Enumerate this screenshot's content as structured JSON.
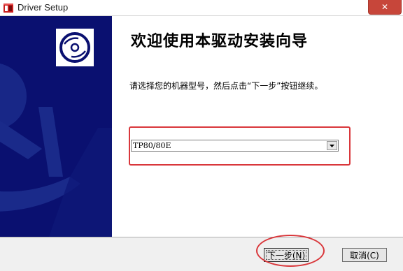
{
  "window": {
    "title": "Driver Setup",
    "close_label": "✕"
  },
  "content": {
    "heading": "欢迎使用本驱动安装向导",
    "instruction": "请选择您的机器型号，然后点击“下一步”按钮继续。"
  },
  "model_select": {
    "selected_value": "TP80/80E"
  },
  "buttons": {
    "next_label": "下一步(N)",
    "cancel_label": "取消(C)"
  },
  "colors": {
    "banner": "#0a1070",
    "annotation_red": "#d9373b",
    "close_button": "#c7463a"
  },
  "icons": {
    "app": "setup-app-icon",
    "banner": "compact-disc-icon",
    "dropdown": "dropdown-arrow-icon"
  }
}
